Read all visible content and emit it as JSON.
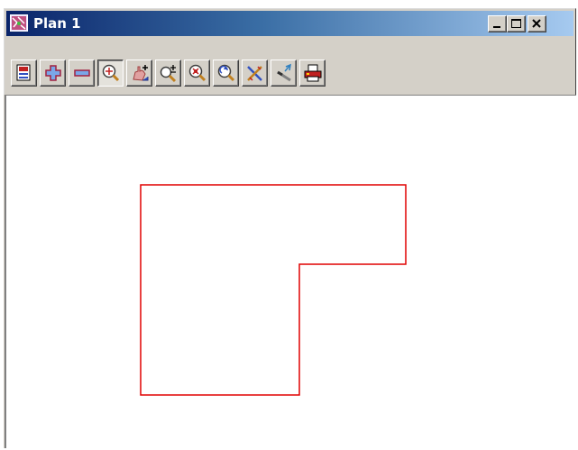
{
  "window": {
    "title": "Plan 1",
    "caption_buttons": [
      "minimize-icon",
      "maximize-icon",
      "close-icon"
    ]
  },
  "toolbar": {
    "buttons": [
      {
        "name": "plot-icon",
        "pressed": false
      },
      {
        "name": "zoom-in-plus-icon",
        "pressed": false
      },
      {
        "name": "zoom-out-minus-icon",
        "pressed": false
      },
      {
        "name": "zoom-extent-icon",
        "pressed": true
      },
      {
        "name": "pan-hand-icon",
        "pressed": false
      },
      {
        "name": "zoom-window-icon",
        "pressed": false
      },
      {
        "name": "zoom-center-icon",
        "pressed": false
      },
      {
        "name": "zoom-previous-icon",
        "pressed": false
      },
      {
        "name": "tools-cross-icon",
        "pressed": false
      },
      {
        "name": "pick-tool-icon",
        "pressed": false
      },
      {
        "name": "print-icon",
        "pressed": false
      }
    ]
  },
  "canvas": {
    "shape": "L-shaped polygon",
    "stroke_color": "#e00000",
    "background": "#ffffff"
  },
  "colors": {
    "titlebar_start": "#0a246a",
    "titlebar_end": "#a6caf0",
    "chrome": "#d4d0c8"
  }
}
